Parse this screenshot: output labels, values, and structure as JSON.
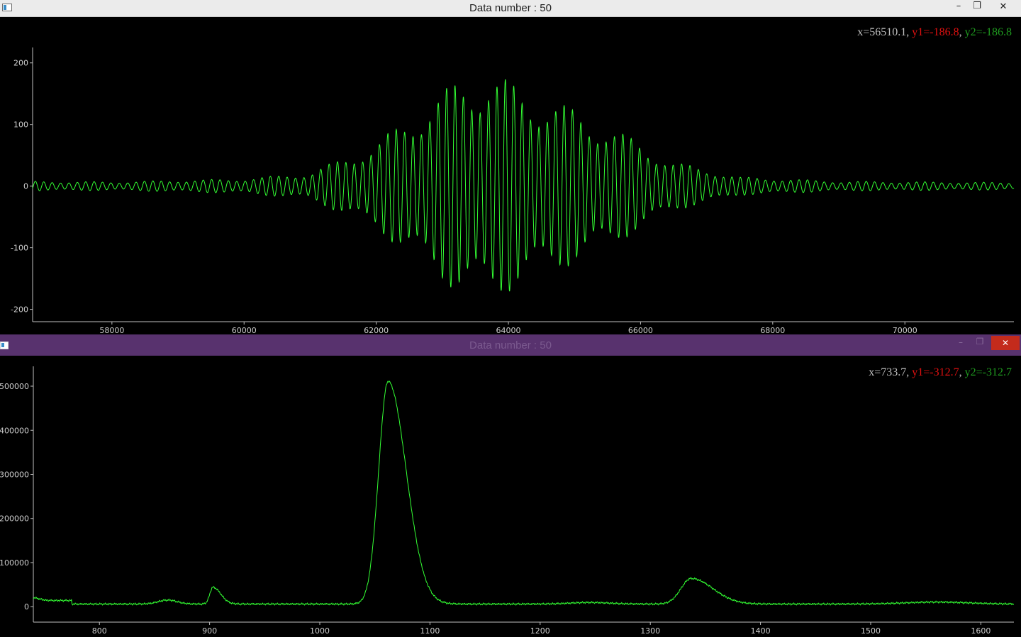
{
  "windows": [
    {
      "title": "Data number : 50",
      "readout": {
        "x": "x=56510.1",
        "y1": "y1=-186.8",
        "y2": "y2=-186.8",
        "sep1": ", ",
        "sep2": ", "
      },
      "titlebar_color": "#ebebeb",
      "title_color": "#222222",
      "controls": {
        "minimize": "–",
        "restore": "❐",
        "close": "✕"
      }
    },
    {
      "title": "Data number : 50",
      "readout": {
        "x": "x=733.7",
        "y1": "y1=-312.7",
        "y2": "y2=-312.7",
        "sep1": ", ",
        "sep2": ", "
      },
      "titlebar_color": "#58326e",
      "title_color": "#7b5a8f",
      "controls": {
        "minimize": "–",
        "restore": "❐",
        "close": "✕"
      }
    }
  ],
  "colors": {
    "trace": "#33ff33",
    "readout_x": "#c0c0c0",
    "readout_y1": "#e01010",
    "readout_y2": "#1f9a1f",
    "axis": "#bfbfbf",
    "close_active": "#c42b1c"
  },
  "chart_data": [
    {
      "type": "line",
      "title": "",
      "xlabel": "",
      "ylabel": "",
      "xlim": [
        56800,
        71650
      ],
      "ylim": [
        -220,
        225
      ],
      "xticks": [
        58000,
        60000,
        62000,
        64000,
        66000,
        68000,
        70000
      ],
      "yticks": [
        200,
        100,
        0,
        -100,
        -200
      ],
      "grid": false,
      "series": [
        {
          "description": "interferogram-like oscillation, carrier period ~127, Gaussian envelope centred ~63700",
          "envelope_points": {
            "x": [
              56800,
              58000,
              60000,
              61000,
              62000,
              62800,
              63200,
              63700,
              64200,
              64700,
              65500,
              66500,
              67500,
              69000,
              71650
            ],
            "amplitude": [
              8,
              7,
              12,
              22,
              70,
              140,
              170,
              190,
              160,
              140,
              100,
              40,
              15,
              8,
              6
            ]
          }
        }
      ]
    },
    {
      "type": "line",
      "title": "",
      "xlabel": "",
      "ylabel": "",
      "xlim": [
        740,
        1630
      ],
      "ylim": [
        -35000,
        545000
      ],
      "xticks": [
        800,
        900,
        1000,
        1100,
        1200,
        1300,
        1400,
        1500,
        1600
      ],
      "yticks": [
        500000,
        400000,
        300000,
        200000,
        100000,
        0
      ],
      "grid": false,
      "series": [
        {
          "description": "spectrum with main peak ~1062 and secondary peaks ~903 and ~1337",
          "peaks": [
            {
              "center": 1062,
              "height": 505000
            },
            {
              "center": 903,
              "height": 38000
            },
            {
              "center": 1337,
              "height": 60000
            },
            {
              "center": 862,
              "height": 10000
            }
          ],
          "baseline": 6000
        }
      ]
    }
  ]
}
